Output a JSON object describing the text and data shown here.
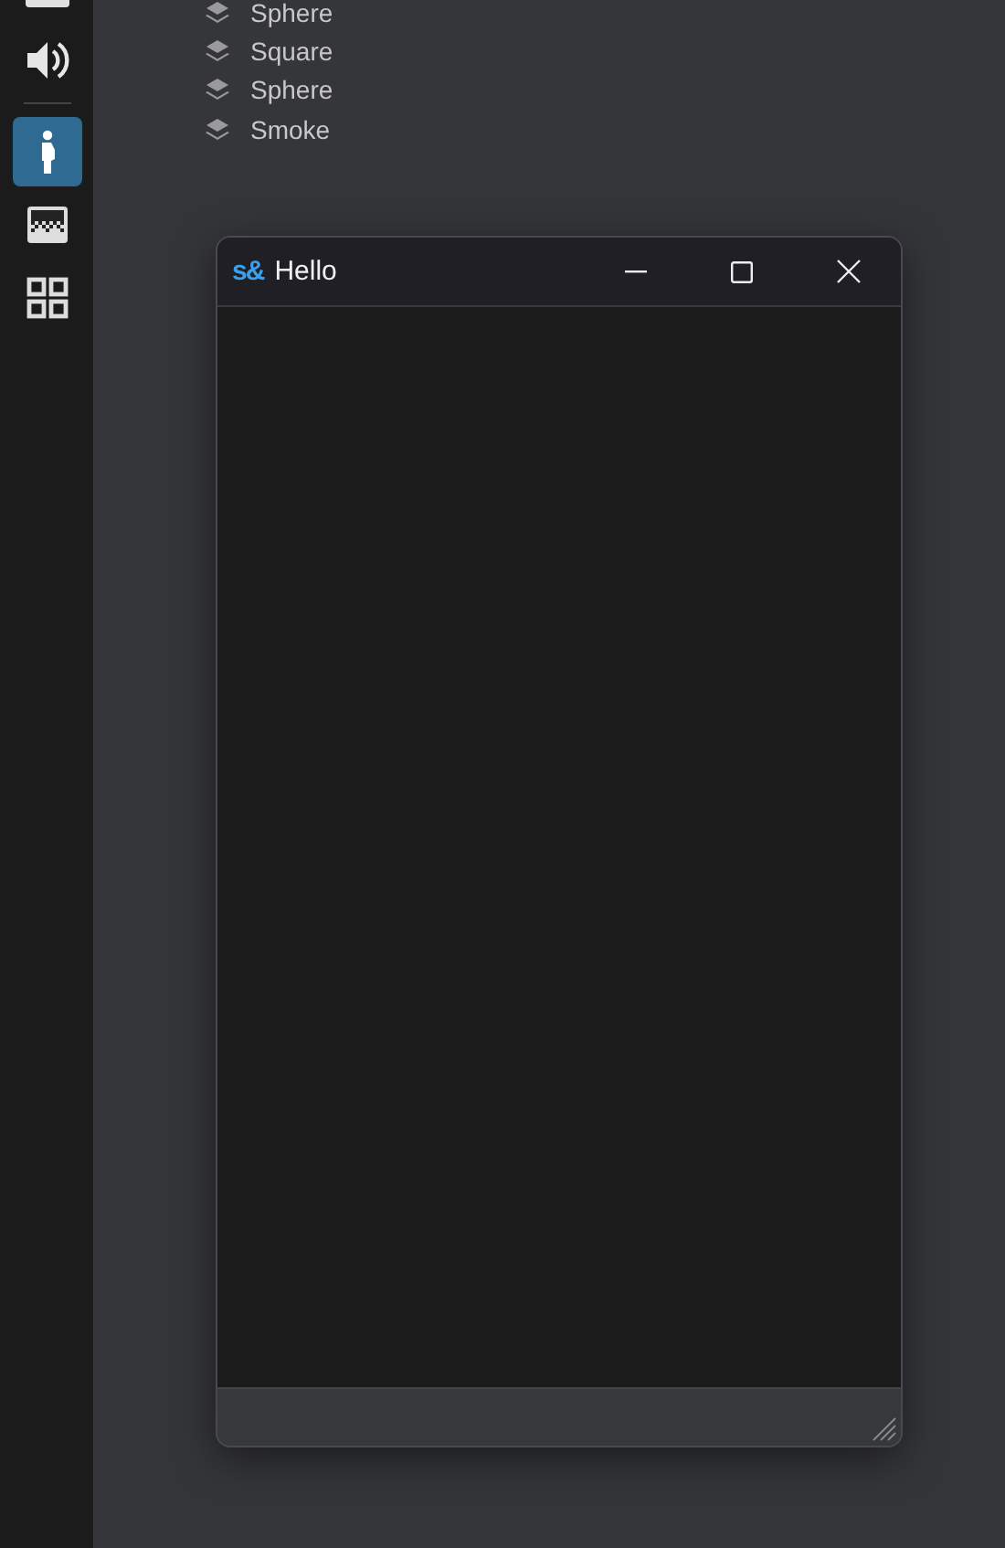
{
  "sidebar": {
    "items": [
      {
        "kind": "panel",
        "selected": false
      },
      {
        "kind": "speaker",
        "selected": false
      },
      {
        "kind": "divider"
      },
      {
        "kind": "figure",
        "selected": true
      },
      {
        "kind": "gradient",
        "selected": false
      },
      {
        "kind": "grid",
        "selected": false
      }
    ]
  },
  "layers": [
    {
      "name": "Sphere"
    },
    {
      "name": "Square"
    },
    {
      "name": "Sphere"
    },
    {
      "name": "Smoke"
    }
  ],
  "window": {
    "logo": "s&",
    "title": "Hello"
  }
}
